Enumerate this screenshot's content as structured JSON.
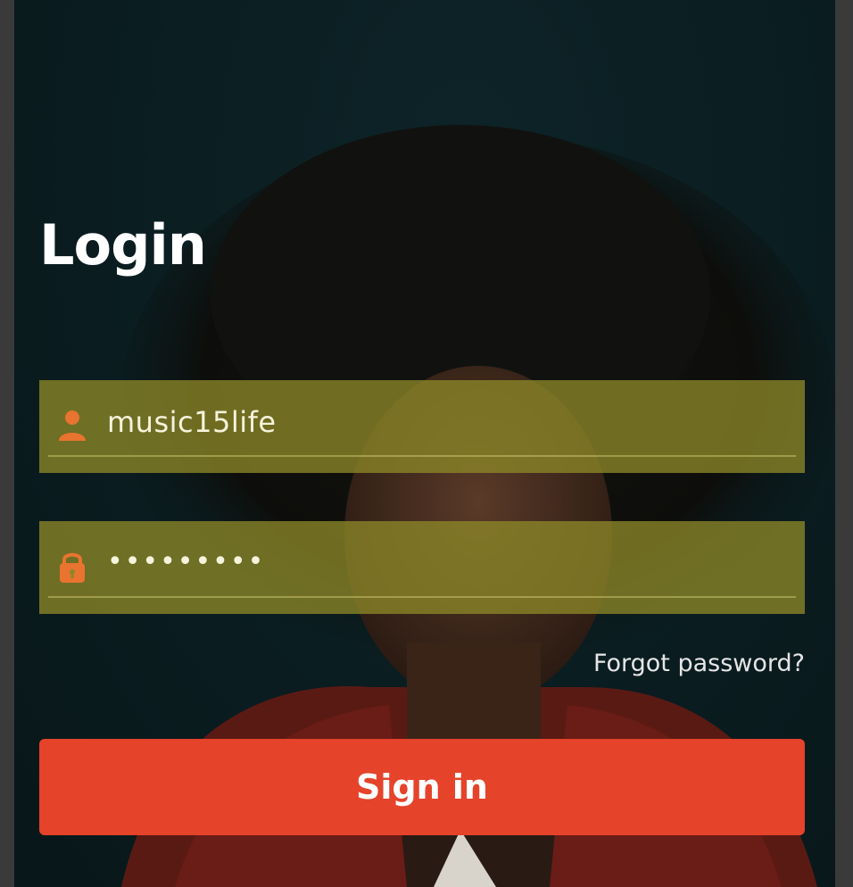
{
  "login": {
    "title": "Login",
    "username": {
      "value": "music15life",
      "icon": "user-icon"
    },
    "password": {
      "value": "•••••••••",
      "icon": "lock-icon"
    },
    "forgot_label": "Forgot password?",
    "signin_label": "Sign in"
  },
  "colors": {
    "background": "#0a1c20",
    "field_fill": "#8c8728",
    "accent": "#e5432a",
    "icon": "#e8742f",
    "text": "#ffffff"
  }
}
